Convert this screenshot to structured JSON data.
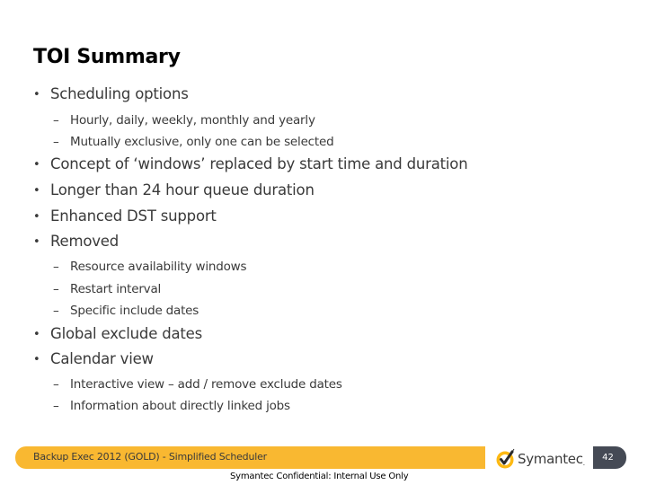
{
  "slide": {
    "title": "TOI Summary",
    "items": [
      {
        "level": 1,
        "text": "Scheduling options"
      },
      {
        "level": 2,
        "text": "Hourly, daily, weekly, monthly and yearly"
      },
      {
        "level": 2,
        "text": "Mutually exclusive, only one can be selected"
      },
      {
        "level": 1,
        "text": "Concept of ‘windows’ replaced by start time and  duration"
      },
      {
        "level": 1,
        "text": "Longer than 24 hour queue duration"
      },
      {
        "level": 1,
        "text": "Enhanced DST support"
      },
      {
        "level": 1,
        "text": "Removed"
      },
      {
        "level": 2,
        "text": "Resource availability windows"
      },
      {
        "level": 2,
        "text": "Restart interval"
      },
      {
        "level": 2,
        "text": "Specific include dates"
      },
      {
        "level": 1,
        "text": "Global exclude dates"
      },
      {
        "level": 1,
        "text": "Calendar view"
      },
      {
        "level": 2,
        "text": "Interactive view – add / remove exclude dates"
      },
      {
        "level": 2,
        "text": "Information about directly linked jobs"
      }
    ],
    "bullet_glyph": "•",
    "dash_glyph": "–"
  },
  "footer": {
    "bar_text": "Backup Exec 2012 (GOLD) - Simplified Scheduler",
    "logo_text": "Symantec",
    "logo_icon": "checkmark-circle-icon",
    "page_number": "42",
    "confidential": "Symantec Confidential:  Internal Use Only",
    "bar_color": "#f9b831",
    "badge_color": "#454a55"
  }
}
